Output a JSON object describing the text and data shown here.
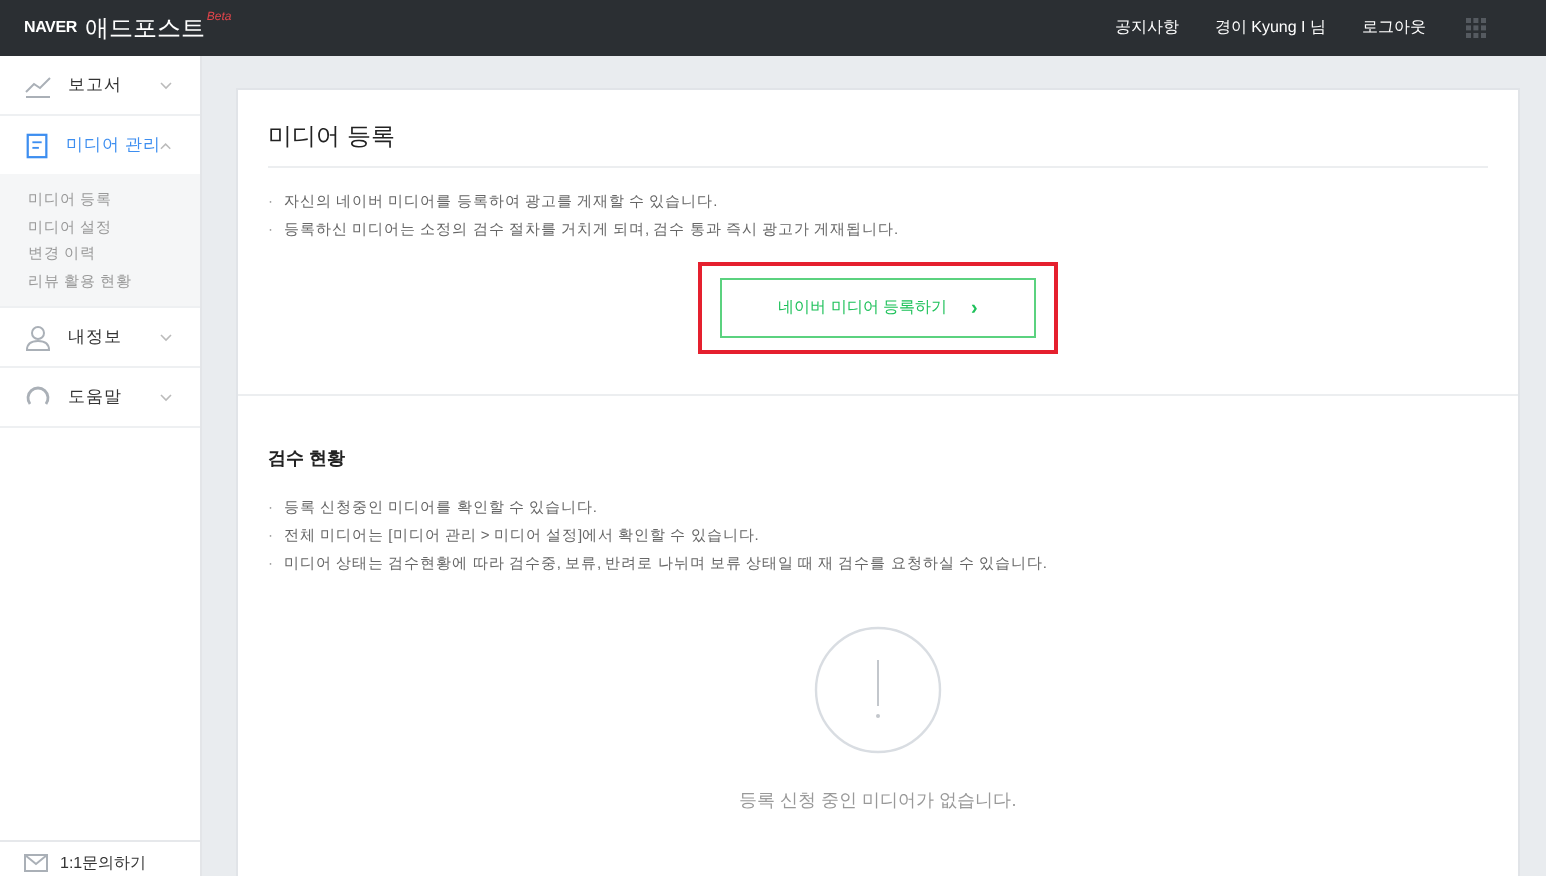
{
  "header": {
    "logo": "NAVER",
    "title": "애드포스트",
    "badge": "Beta",
    "links": [
      "공지사항",
      "경이 Kyung I 님",
      "로그아웃"
    ]
  },
  "sidebar": {
    "items": [
      {
        "label": "보고서",
        "expanded": false
      },
      {
        "label": "미디어 관리",
        "expanded": true,
        "children": [
          {
            "label": "미디어 등록"
          },
          {
            "label": "미디어 설정"
          },
          {
            "label": "변경 이력"
          },
          {
            "label": "리뷰 활용 현황"
          }
        ]
      },
      {
        "label": "내정보",
        "expanded": false
      },
      {
        "label": "도움말",
        "expanded": false
      }
    ],
    "footer": {
      "label": "1:1문의하기"
    }
  },
  "register": {
    "title": "미디어 등록",
    "bullet": "·",
    "notes": [
      "자신의 네이버 미디어를 등록하여 광고를 게재할 수 있습니다.",
      "등록하신 미디어는 소정의 검수 절차를 거치게 되며, 검수 통과 즉시 광고가 게재됩니다."
    ],
    "button": {
      "label": "네이버 미디어 등록하기",
      "arrow": "›"
    }
  },
  "review": {
    "title": "검수 현황",
    "bullet": "·",
    "notes": [
      "등록 신청중인 미디어를 확인할 수 있습니다.",
      "전체 미디어는 [미디어 관리 > 미디어 설정]에서 확인할 수 있습니다.",
      "미디어 상태는 검수현황에 따라 검수중, 보류, 반려로 나뉘며 보류 상태일 때 재 검수를 요청하실 수 있습니다."
    ],
    "empty": "등록 신청 중인 미디어가 없습니다."
  }
}
